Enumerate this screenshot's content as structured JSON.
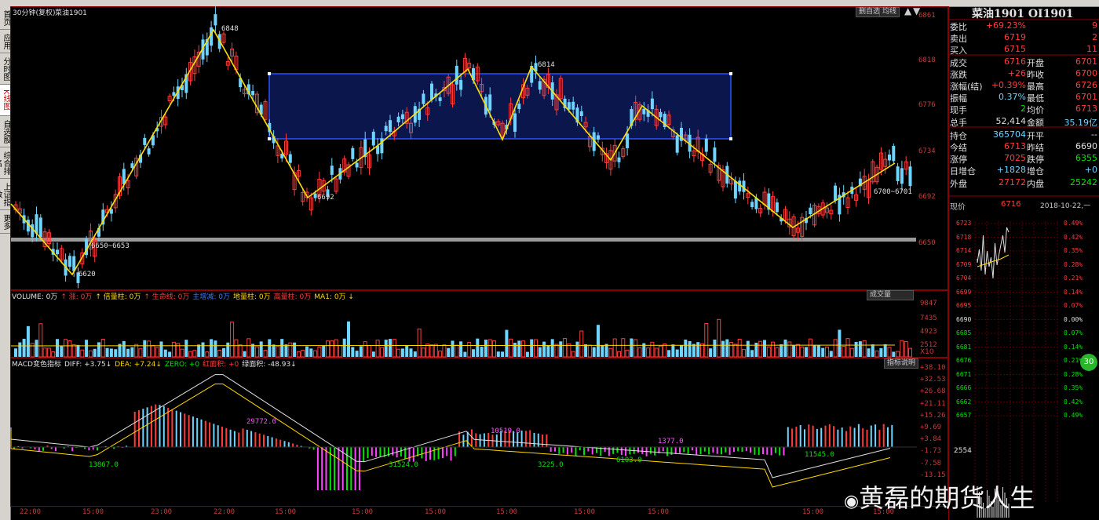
{
  "chart_header": {
    "period": "30分钟(复权)",
    "symbol": "菜油1901"
  },
  "top_right_buttons": [
    "删自选",
    "均线"
  ],
  "left_tabs": [
    {
      "label": "首页",
      "active": false
    },
    {
      "label": "应用",
      "active": false
    },
    {
      "label": "分时图",
      "active": false
    },
    {
      "label": "K线图",
      "active": true
    },
    {
      "label": "自选股",
      "active": false
    },
    {
      "label": "综合排名",
      "active": false
    },
    {
      "label": "上证指数",
      "active": false
    },
    {
      "label": "更多",
      "active": false
    }
  ],
  "price_axis": {
    "labels": [
      "6861",
      "6818",
      "6776",
      "6734",
      "6692",
      "6650"
    ]
  },
  "time_axis": {
    "labels": [
      "22:00",
      "15:00",
      "23:00",
      "22:00",
      "15:00",
      "15:00",
      "15:00",
      "15:00",
      "15:00",
      "15:00",
      "15:00",
      "15:00"
    ]
  },
  "annotations": {
    "high1": "6848",
    "low1": "6620",
    "low2": "6692",
    "high2": "6814",
    "support": "6650~6653",
    "resistance": "6700~6701"
  },
  "volume_panel": {
    "header": [
      {
        "text": "VOLUME: 0万",
        "color": "#e0e0e0"
      },
      {
        "text": "↑ 涨: 0万",
        "color": "#ff3c3c"
      },
      {
        "text": "↑ 倍量柱: 0万",
        "color": "#ffd800"
      },
      {
        "text": "↑ 生命线: 0万",
        "color": "#ff3c3c"
      },
      {
        "text": "主增减: 0万",
        "color": "#3c78ff"
      },
      {
        "text": "地量柱: 0万",
        "color": "#ffd800"
      },
      {
        "text": "高量柱: 0万",
        "color": "#ff3c3c"
      },
      {
        "text": "MA1: 0万 ↓",
        "color": "#ffd800"
      }
    ],
    "dropdown": "成交量",
    "axis": [
      "9847",
      "7435",
      "4923",
      "2512"
    ],
    "multiplier": "X10"
  },
  "macd_panel": {
    "header": [
      {
        "text": "MACD变色指标",
        "color": "#e0e0e0"
      },
      {
        "text": "DIFF: +3.75↓",
        "color": "#e0e0e0"
      },
      {
        "text": "DEA: +7.24↓",
        "color": "#ffd800"
      },
      {
        "text": "ZERO: +0",
        "color": "#00e600"
      },
      {
        "text": "红面积: +0",
        "color": "#ff3c3c"
      },
      {
        "text": "绿面积: -48.93↓",
        "color": "#e0e0e0"
      }
    ],
    "help_button": "指标说明",
    "axis": [
      "+38.10",
      "+32.53",
      "+26.68",
      "+21.11",
      "+15.26",
      "+9.69",
      "+3.84",
      "-1.73",
      "-7.58",
      "-13.15"
    ],
    "area_labels": [
      {
        "text": "29772.0",
        "color": "#ff55ff"
      },
      {
        "text": "13867.0",
        "color": "#00e600"
      },
      {
        "text": "31524.0",
        "color": "#00e600"
      },
      {
        "text": "10519.0",
        "color": "#ff55ff"
      },
      {
        "text": "3225.0",
        "color": "#00e600"
      },
      {
        "text": "6103.0",
        "color": "#00e600"
      },
      {
        "text": "1377.0",
        "color": "#ff55ff"
      },
      {
        "text": "11545.0",
        "color": "#00e600"
      }
    ]
  },
  "quote_panel": {
    "title": "菜油1901 OI1901",
    "rows": [
      {
        "l1": "委比",
        "v1": "+69.23%",
        "c1": "red",
        "l2": "",
        "v2": "9",
        "c2": "red"
      },
      {
        "l1": "卖出",
        "v1": "6719",
        "c1": "red",
        "l2": "",
        "v2": "2",
        "c2": "red"
      },
      {
        "l1": "买入",
        "v1": "6715",
        "c1": "red",
        "l2": "",
        "v2": "11",
        "c2": "red"
      },
      {
        "l1": "成交",
        "v1": "6716",
        "c1": "red",
        "l2": "开盘",
        "v2": "6701",
        "c2": "red"
      },
      {
        "l1": "涨跌",
        "v1": "+26",
        "c1": "red",
        "l2": "昨收",
        "v2": "6700",
        "c2": "red"
      },
      {
        "l1": "涨幅(结)",
        "v1": "+0.39%",
        "c1": "red",
        "l2": "最高",
        "v2": "6726",
        "c2": "red"
      },
      {
        "l1": "振幅",
        "v1": "0.37%",
        "c1": "cyn",
        "l2": "最低",
        "v2": "6701",
        "c2": "red"
      },
      {
        "l1": "现手",
        "v1": "2",
        "c1": "grn",
        "l2": "均价",
        "v2": "6713",
        "c2": "red"
      },
      {
        "l1": "总手",
        "v1": "52,414",
        "c1": "wht",
        "l2": "金额",
        "v2": "35.19亿",
        "c2": "cyn"
      },
      {
        "l1": "持仓",
        "v1": "365704",
        "c1": "cyn",
        "l2": "开平",
        "v2": "--",
        "c2": "wht"
      },
      {
        "l1": "今结",
        "v1": "6713",
        "c1": "red",
        "l2": "昨结",
        "v2": "6690",
        "c2": "wht"
      },
      {
        "l1": "涨停",
        "v1": "7025",
        "c1": "red",
        "l2": "跌停",
        "v2": "6355",
        "c2": "grn"
      },
      {
        "l1": "日增仓",
        "v1": "+1828",
        "c1": "cyn",
        "l2": "增仓",
        "v2": "+0",
        "c2": "cyn"
      },
      {
        "l1": "外盘",
        "v1": "27172",
        "c1": "red",
        "l2": "内盘",
        "v2": "25242",
        "c2": "grn"
      }
    ],
    "current_label": "现价",
    "current_price": "6716",
    "date": "2018-10-22,一",
    "mini_price_axis": [
      "6723",
      "6718",
      "6714",
      "6709",
      "6704",
      "6699",
      "6695",
      "6690",
      "6685",
      "6681",
      "6676",
      "6671",
      "6666",
      "6662",
      "6657"
    ],
    "mini_pct_axis": [
      "0.49%",
      "0.42%",
      "0.35%",
      "0.28%",
      "0.21%",
      "0.14%",
      "0.07%",
      "0.00%",
      "0.07%",
      "0.14%",
      "0.21%",
      "0.28%",
      "0.35%",
      "0.42%",
      "0.49%"
    ],
    "mini_volume": "2554",
    "side_badge": "30"
  },
  "watermark": "黄磊的期货人生"
}
